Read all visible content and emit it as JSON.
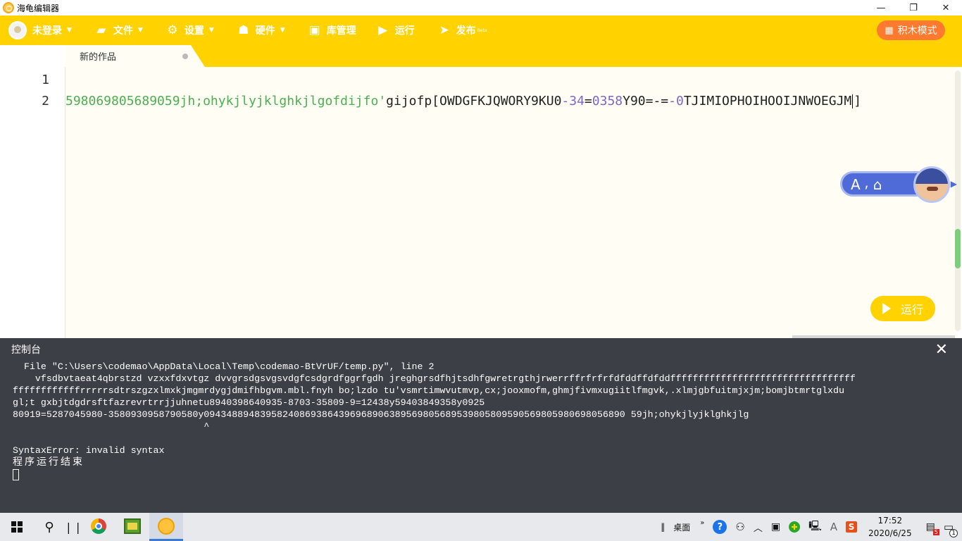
{
  "window": {
    "title": "海龟编辑器",
    "minimize": "—",
    "restore": "❐",
    "close": "✕"
  },
  "menubar": {
    "user": "未登录",
    "file": "文件",
    "settings": "设置",
    "hardware": "硬件",
    "library": "库管理",
    "run": "运行",
    "publish": "发布",
    "publish_badge": "Beta",
    "mode_button": "积木模式"
  },
  "tabs": [
    {
      "label": "新的作品"
    }
  ],
  "editor": {
    "line_numbers": [
      "1",
      "2"
    ],
    "line2_tokens": [
      {
        "kind": "str",
        "text": "598069805689059jh;ohykjlyjklghkjlgofdijfo'"
      },
      {
        "kind": "text",
        "text": "gijofp[OWDGFKJQWORY9KU0"
      },
      {
        "kind": "num",
        "text": "-34"
      },
      {
        "kind": "text",
        "text": "="
      },
      {
        "kind": "num",
        "text": "0358"
      },
      {
        "kind": "text",
        "text": "Y90=-="
      },
      {
        "kind": "num",
        "text": "-0"
      },
      {
        "kind": "text",
        "text": "TJIMIOPHOIHOOIJNWOEGJM"
      },
      {
        "kind": "caret",
        "text": ""
      },
      {
        "kind": "text",
        "text": "]"
      }
    ],
    "run_button": "运行"
  },
  "assistant": {
    "glyphs": "A ⸴ ⌂"
  },
  "console": {
    "title": "控制台",
    "close": "✕",
    "lines": [
      "  File \"C:\\Users\\codemao\\AppData\\Local\\Temp\\codemao-BtVrUF/temp.py\", line 2",
      "    vfsdbvtaeat4qbrstzd vzxxfdxvtgz dvvgrsdgsvgsvdgfcsdgrdfggrfgdh jreghgrsdfhjtsdhfgwretrgthjrwerrffrfrfrfdfddffdfddfffffffffffffffffffffffffffffffff",
      "ffffffffffffrrrrrsdtrszgzxlmxkjmgmrdygjdmifhbgvm.mbl.fnyh bo;lzdo tu'vsmrtimwvutmvp,cx;jooxmofm,ghmjfivmxugiitlfmgvk,.xlmjgbfuitmjxjm;bomjbtmrtglxdu",
      "gl;t gxbjtdgdrsftfazrevrtrrjjuhnetu8940398640935-8703-35809-9=12438y59403849358y0925",
      "80919=5287045980-3580930958790580y094348894839582408693864396968906389569805689539805809590569805980698056890 59jh;ohykjlyjklghkjlg",
      "                                  ^",
      "",
      "SyntaxError: invalid syntax",
      "程序运行结束"
    ]
  },
  "taskbar": {
    "desktop_label": "桌面",
    "more": "»",
    "time": "17:52",
    "date": "2020/6/25",
    "notif_badge": "5",
    "notif_count": "1"
  }
}
